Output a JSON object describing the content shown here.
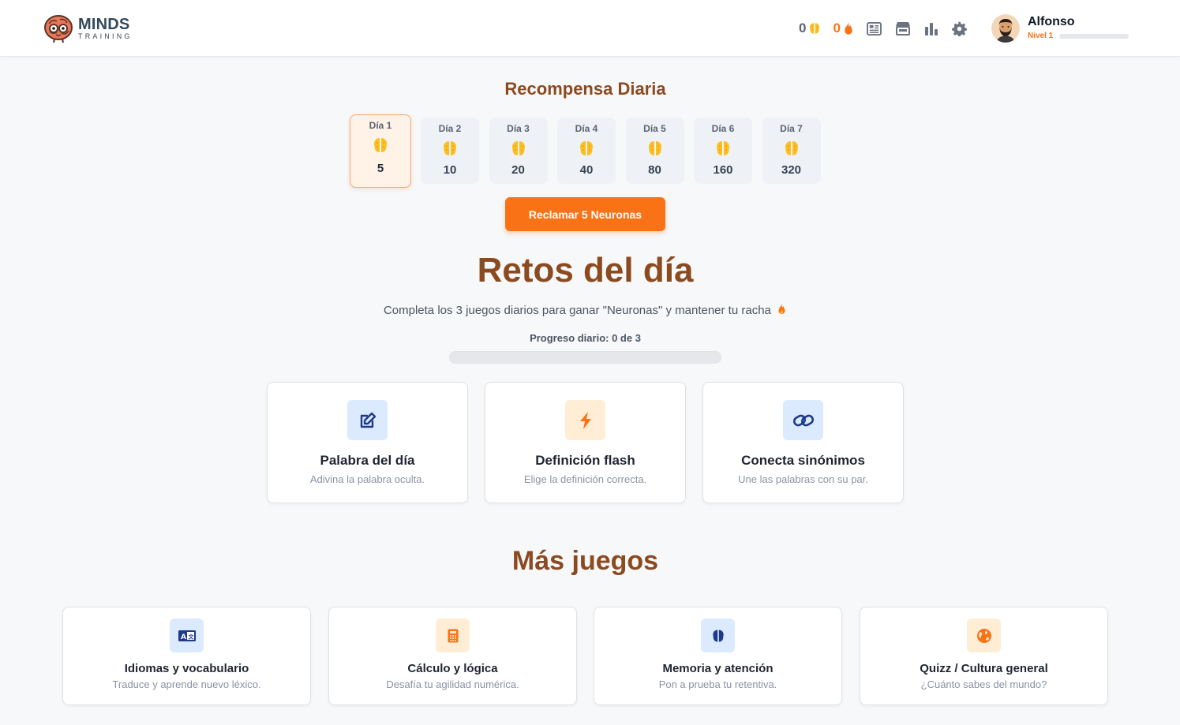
{
  "header": {
    "logo_title": "MINDS",
    "logo_subtitle": "TRAINING",
    "neurons_count": "0",
    "streak_count": "0",
    "nav_icons": [
      "newspaper-icon",
      "store-icon",
      "stats-icon",
      "gear-icon"
    ],
    "user_name": "Alfonso",
    "user_level": "Nivel 1",
    "level_progress": 0
  },
  "reward": {
    "title": "Recompensa Diaria",
    "days": [
      {
        "label": "Día 1",
        "value": "5"
      },
      {
        "label": "Día 2",
        "value": "10"
      },
      {
        "label": "Día 3",
        "value": "20"
      },
      {
        "label": "Día 4",
        "value": "40"
      },
      {
        "label": "Día 5",
        "value": "80"
      },
      {
        "label": "Día 6",
        "value": "160"
      },
      {
        "label": "Día 7",
        "value": "320"
      }
    ],
    "claim_label": "Reclamar 5 Neuronas"
  },
  "retos": {
    "title": "Retos del día",
    "subtitle": "Completa los 3 juegos diarios para ganar \"Neuronas\" y mantener tu racha",
    "progress_label": "Progreso diario: 0 de 3",
    "progress": 0,
    "cards": [
      {
        "title": "Palabra del día",
        "desc": "Adivina la palabra oculta.",
        "icon": "edit-icon"
      },
      {
        "title": "Definición flash",
        "desc": "Elige la definición correcta.",
        "icon": "bolt-icon"
      },
      {
        "title": "Conecta sinónimos",
        "desc": "Une las palabras con su par.",
        "icon": "link-icon"
      }
    ]
  },
  "mas_juegos": {
    "title": "Más juegos",
    "cards": [
      {
        "title": "Idiomas y vocabulario",
        "desc": "Traduce y aprende nuevo léxico.",
        "icon": "language-icon"
      },
      {
        "title": "Cálculo y lógica",
        "desc": "Desafía tu agilidad numérica.",
        "icon": "calculator-icon"
      },
      {
        "title": "Memoria y atención",
        "desc": "Pon a prueba tu retentiva.",
        "icon": "brain-icon"
      },
      {
        "title": "Quizz / Cultura general",
        "desc": "¿Cuánto sabes del mundo?",
        "icon": "globe-icon"
      }
    ]
  },
  "colors": {
    "accent": "#f97316",
    "heading": "#8b4a1f",
    "neuron": "#fbbf24"
  }
}
